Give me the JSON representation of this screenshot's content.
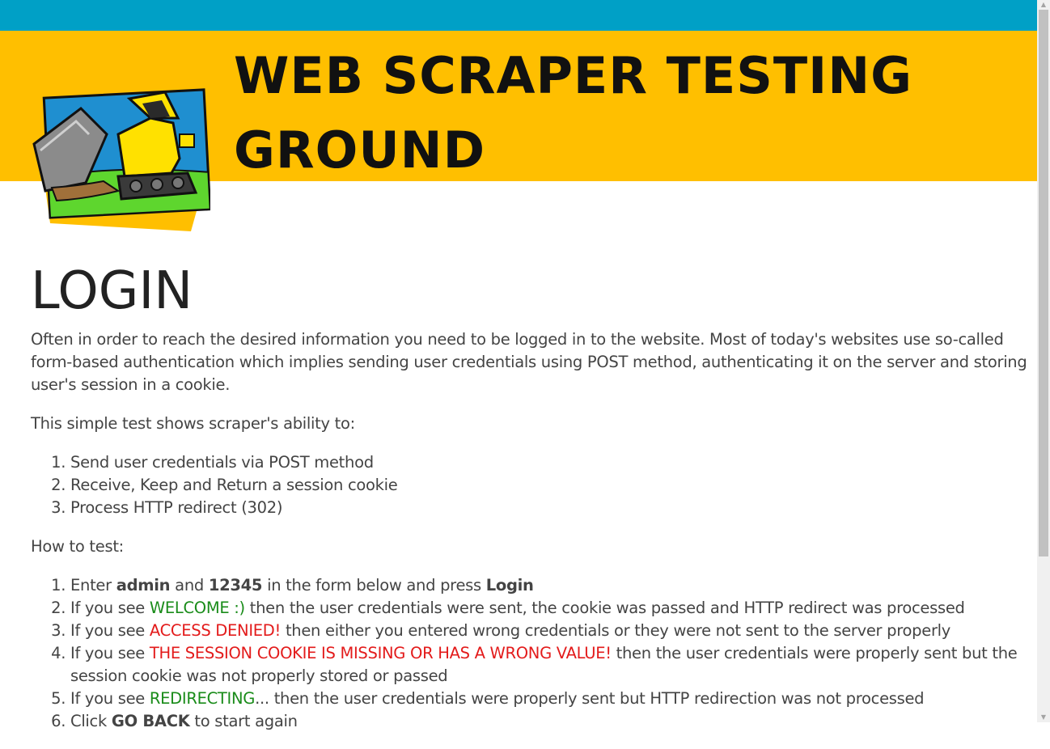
{
  "colors": {
    "top_strip": "#00a0c6",
    "banner": "#ffbf00",
    "text": "#444444",
    "success": "#1a8c1a",
    "error": "#e31b1b"
  },
  "header": {
    "logo_icon": "bulldozer-icon",
    "title_line1": "WEB SCRAPER TESTING",
    "title_line2": "GROUND"
  },
  "main": {
    "heading": "LOGIN",
    "intro": "Often in order to reach the desired information you need to be logged in to the website. Most of today's websites use so-called form-based authentication which implies sending user credentials using POST method, authenticating it on the server and storing user's session in a cookie.",
    "ability_intro": "This simple test shows scraper's ability to:",
    "abilities": [
      "Send user credentials via POST method",
      "Receive, Keep and Return a session cookie",
      "Process HTTP redirect (302)"
    ],
    "howto_label": "How to test:",
    "steps": {
      "s1": {
        "a": "Enter ",
        "user": "admin",
        "b": " and ",
        "pass": "12345",
        "c": " in the form below and press ",
        "btn": "Login"
      },
      "s2": {
        "a": "If you see ",
        "status": "WELCOME :)",
        "b": " then the user credentials were sent, the cookie was passed and HTTP redirect was processed"
      },
      "s3": {
        "a": "If you see ",
        "status": "ACCESS DENIED!",
        "b": " then either you entered wrong credentials or they were not sent to the server properly"
      },
      "s4": {
        "a": "If you see ",
        "status": "THE SESSION COOKIE IS MISSING OR HAS A WRONG VALUE!",
        "b": " then the user credentials were properly sent but the session cookie was not properly stored or passed"
      },
      "s5": {
        "a": "If you see ",
        "status": "REDIRECTING",
        "b": "... then the user credentials were properly sent but HTTP redirection was not processed"
      },
      "s6": {
        "a": "Click ",
        "link": "GO BACK",
        "b": " to start again"
      }
    }
  }
}
